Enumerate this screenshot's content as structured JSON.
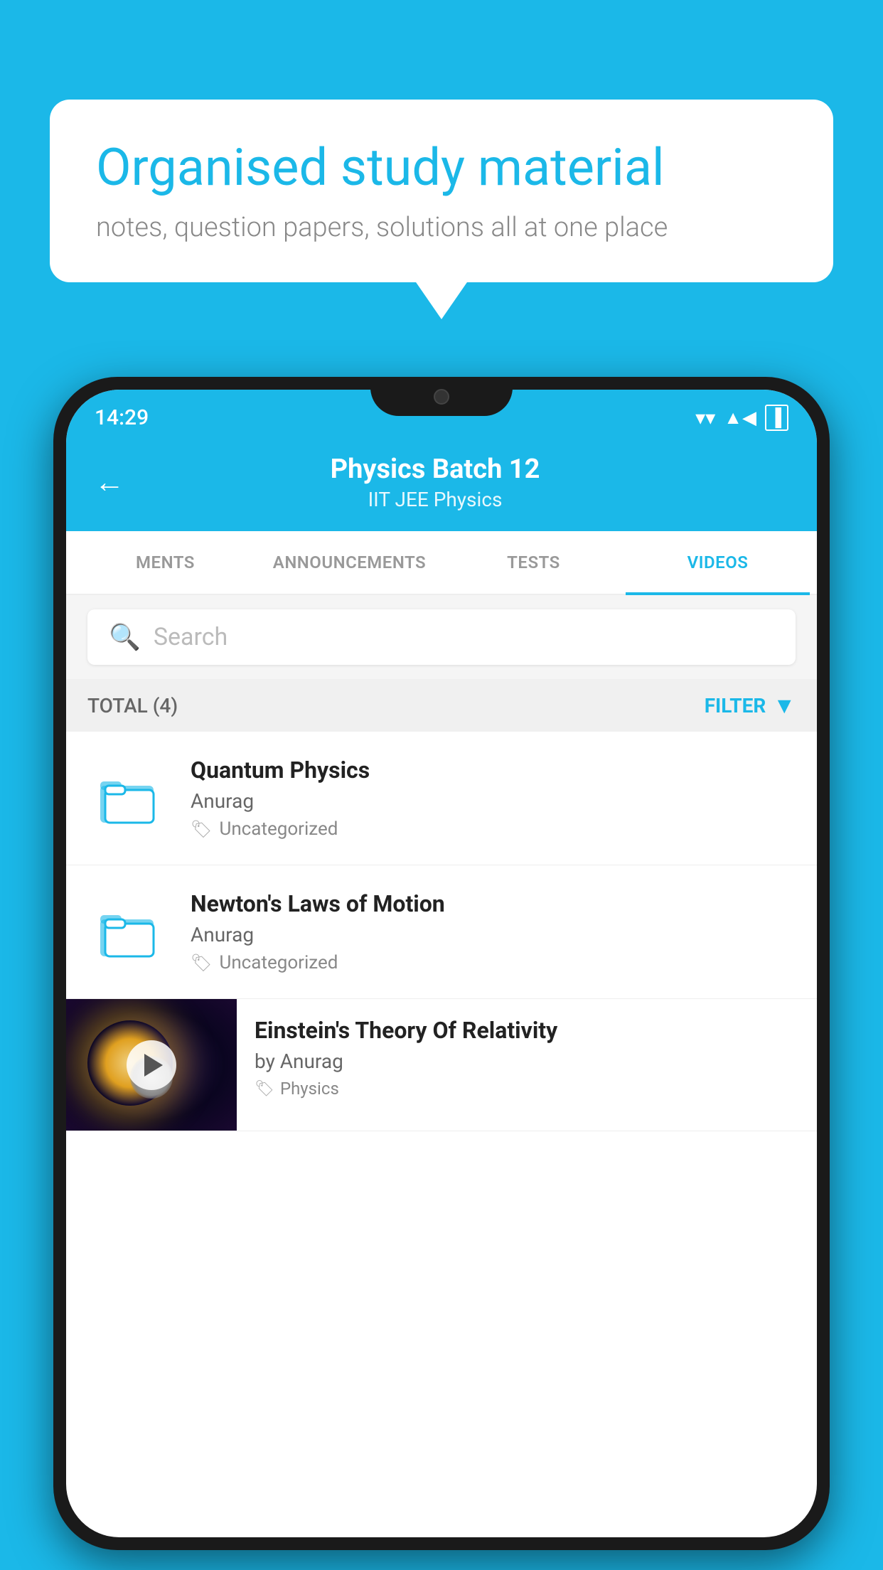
{
  "background_color": "#1BB8E8",
  "speech_bubble": {
    "heading": "Organised study material",
    "subtext": "notes, question papers, solutions all at one place"
  },
  "phone": {
    "status_bar": {
      "time": "14:29",
      "wifi": "▼",
      "signal": "▲",
      "battery": "▐"
    },
    "header": {
      "back_label": "←",
      "title": "Physics Batch 12",
      "subtitle": "IIT JEE    Physics"
    },
    "tabs": [
      {
        "label": "MENTS",
        "active": false
      },
      {
        "label": "ANNOUNCEMENTS",
        "active": false
      },
      {
        "label": "TESTS",
        "active": false
      },
      {
        "label": "VIDEOS",
        "active": true
      }
    ],
    "search": {
      "placeholder": "Search"
    },
    "filter_bar": {
      "total_label": "TOTAL (4)",
      "filter_label": "FILTER"
    },
    "video_items": [
      {
        "title": "Quantum Physics",
        "author": "Anurag",
        "tag": "Uncategorized",
        "type": "folder"
      },
      {
        "title": "Newton's Laws of Motion",
        "author": "Anurag",
        "tag": "Uncategorized",
        "type": "folder"
      },
      {
        "title": "Einstein's Theory Of Relativity",
        "author": "by Anurag",
        "tag": "Physics",
        "type": "video"
      }
    ]
  }
}
